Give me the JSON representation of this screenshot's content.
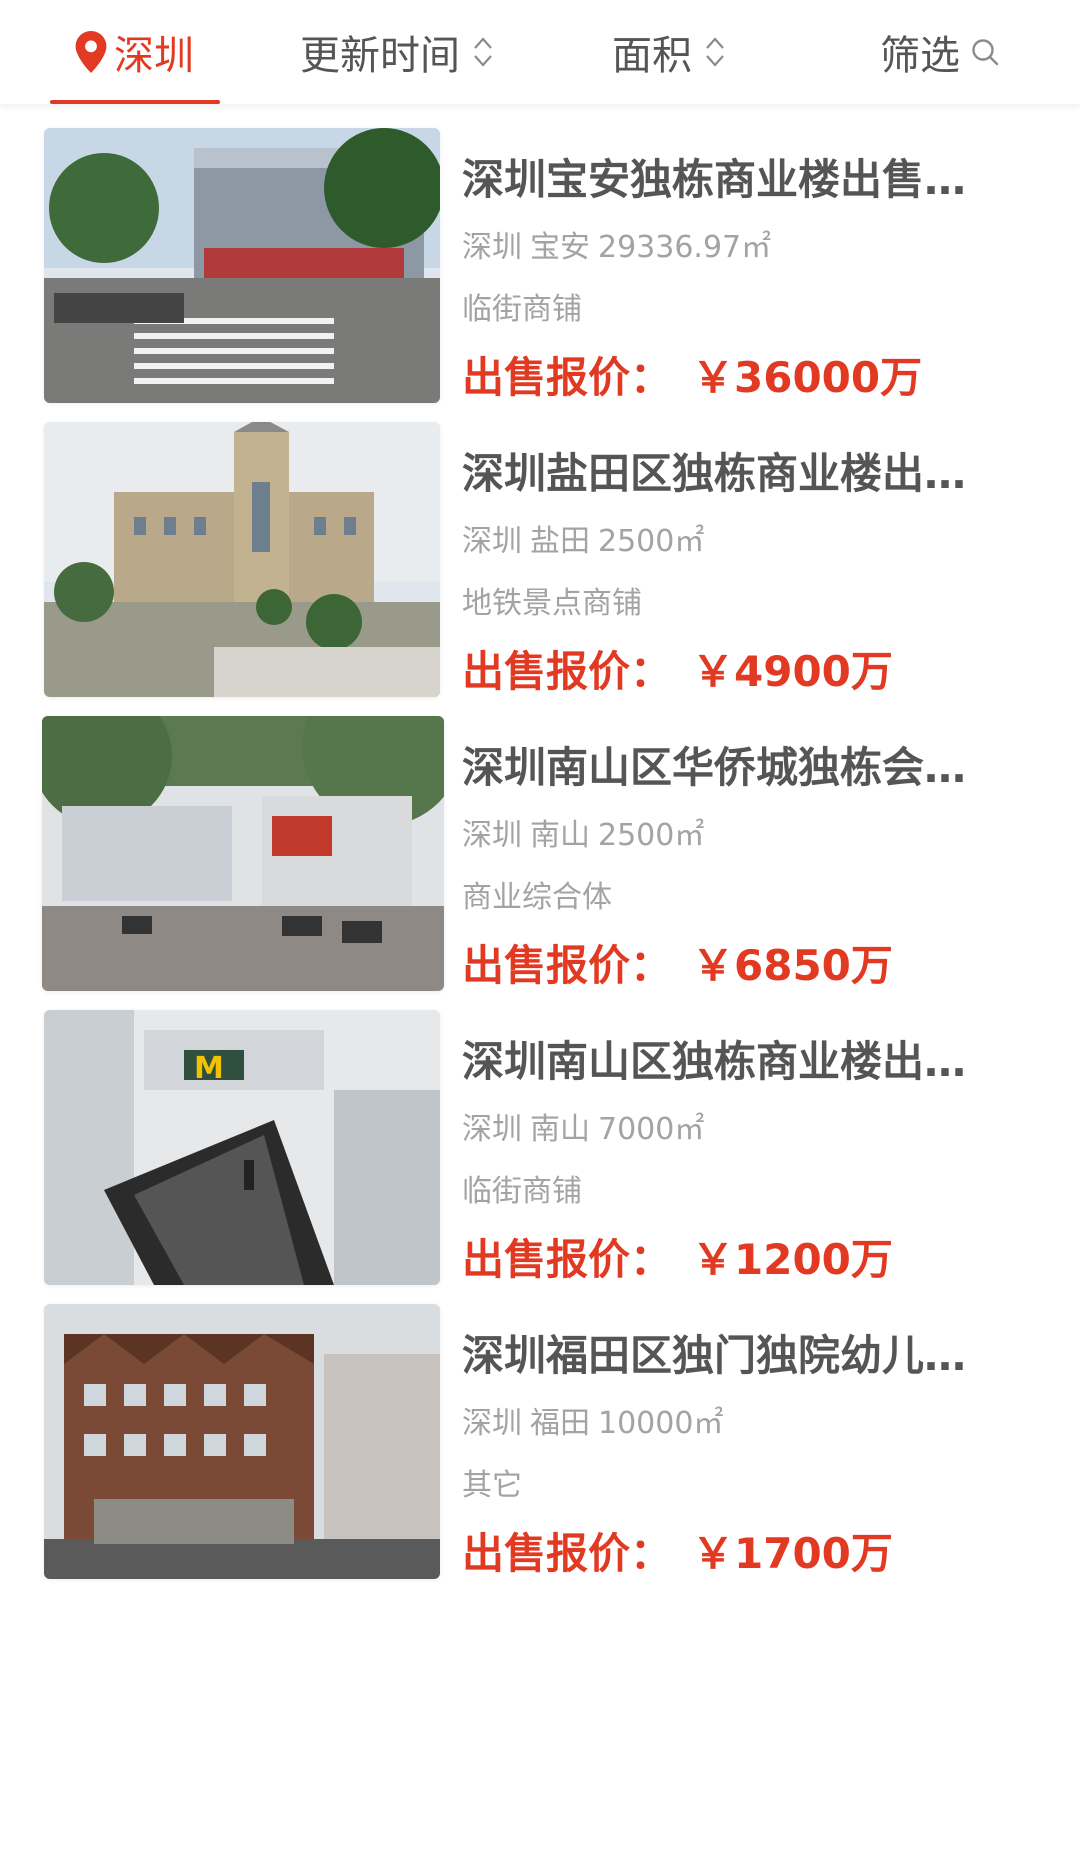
{
  "header": {
    "city": "深圳",
    "sort_update": "更新时间",
    "sort_area": "面积",
    "filter": "筛选"
  },
  "colors": {
    "accent": "#e23a22",
    "text_primary": "#555555",
    "text_secondary": "#a3a3a3"
  },
  "listings": [
    {
      "title": "深圳宝安独栋商业楼出售…",
      "city": "深圳",
      "district": "宝安",
      "area": "29336.97㎡",
      "category": "临街商铺",
      "price_label": "出售报价：",
      "price": "￥36000万"
    },
    {
      "title": "深圳盐田区独栋商业楼出…",
      "city": "深圳",
      "district": "盐田",
      "area": "2500㎡",
      "category": "地铁景点商铺",
      "price_label": "出售报价：",
      "price": "￥4900万"
    },
    {
      "title": "深圳南山区华侨城独栋会…",
      "city": "深圳",
      "district": "南山",
      "area": "2500㎡",
      "category": "商业综合体",
      "price_label": "出售报价：",
      "price": "￥6850万"
    },
    {
      "title": "深圳南山区独栋商业楼出…",
      "city": "深圳",
      "district": "南山",
      "area": "7000㎡",
      "category": "临街商铺",
      "price_label": "出售报价：",
      "price": "￥1200万"
    },
    {
      "title": "深圳福田区独门独院幼儿…",
      "city": "深圳",
      "district": "福田",
      "area": "10000㎡",
      "category": "其它",
      "price_label": "出售报价：",
      "price": "￥1700万"
    }
  ]
}
